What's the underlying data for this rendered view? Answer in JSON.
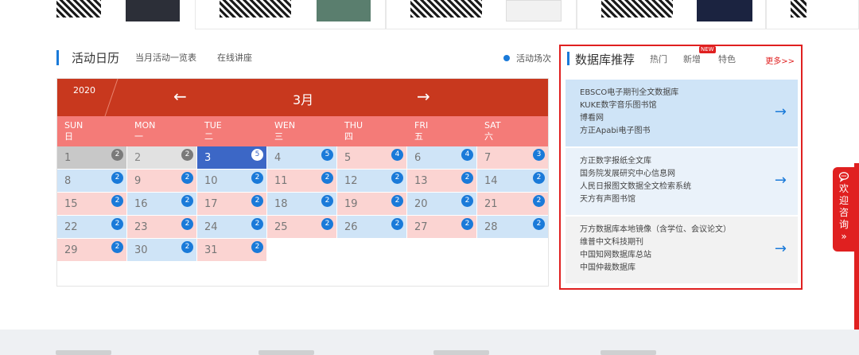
{
  "calendar": {
    "title": "活动日历",
    "tabs": [
      "当月活动一览表",
      "在线讲座"
    ],
    "legend": "活动场次",
    "year": "2020",
    "prev_arrow": "←",
    "month": "3月",
    "next_arrow": "→",
    "weekdays": [
      {
        "en": "SUN",
        "cn": "日"
      },
      {
        "en": "MON",
        "cn": "一"
      },
      {
        "en": "TUE",
        "cn": "二"
      },
      {
        "en": "WEN",
        "cn": "三"
      },
      {
        "en": "THU",
        "cn": "四"
      },
      {
        "en": "FRI",
        "cn": "五"
      },
      {
        "en": "SAT",
        "cn": "六"
      }
    ],
    "days": [
      {
        "d": "1",
        "n": "2"
      },
      {
        "d": "2",
        "n": "2"
      },
      {
        "d": "3",
        "n": "5"
      },
      {
        "d": "4",
        "n": "5"
      },
      {
        "d": "5",
        "n": "4"
      },
      {
        "d": "6",
        "n": "4"
      },
      {
        "d": "7",
        "n": "3"
      },
      {
        "d": "8",
        "n": "2"
      },
      {
        "d": "9",
        "n": "2"
      },
      {
        "d": "10",
        "n": "2"
      },
      {
        "d": "11",
        "n": "2"
      },
      {
        "d": "12",
        "n": "2"
      },
      {
        "d": "13",
        "n": "2"
      },
      {
        "d": "14",
        "n": "2"
      },
      {
        "d": "15",
        "n": "2"
      },
      {
        "d": "16",
        "n": "2"
      },
      {
        "d": "17",
        "n": "2"
      },
      {
        "d": "18",
        "n": "2"
      },
      {
        "d": "19",
        "n": "2"
      },
      {
        "d": "20",
        "n": "2"
      },
      {
        "d": "21",
        "n": "2"
      },
      {
        "d": "22",
        "n": "2"
      },
      {
        "d": "23",
        "n": "2"
      },
      {
        "d": "24",
        "n": "2"
      },
      {
        "d": "25",
        "n": "2"
      },
      {
        "d": "26",
        "n": "2"
      },
      {
        "d": "27",
        "n": "2"
      },
      {
        "d": "28",
        "n": "2"
      },
      {
        "d": "29",
        "n": "2"
      },
      {
        "d": "30",
        "n": "2"
      },
      {
        "d": "31",
        "n": "2"
      }
    ]
  },
  "database": {
    "title": "数据库推荐",
    "tabs": [
      "热门",
      "新增",
      "特色"
    ],
    "new_tag": "NEW",
    "more": "更多>>",
    "groups": [
      {
        "items": [
          "EBSCO电子期刊全文数据库",
          "KUKE数字音乐图书馆",
          "博看网",
          "方正Apabi电子图书"
        ],
        "arrow": "→"
      },
      {
        "items": [
          "方正数字报纸全文库",
          "国务院发展研究中心信息网",
          "人民日报图文数据全文检索系统",
          "天方有声图书馆"
        ],
        "arrow": "→"
      },
      {
        "items": [
          "万方数据库本地镜像（含学位、会议论文）",
          "维普中文科技期刊",
          "中国知网数据库总站",
          "中国仲裁数据库"
        ],
        "arrow": "→"
      }
    ]
  },
  "consult": {
    "icon": "chat-icon",
    "label": "欢迎咨询",
    "chevron": "»"
  },
  "colors": {
    "accent_blue": "#1a7ad9",
    "calendar_red": "#c8381e",
    "weekday_pink": "#f47b78",
    "highlight_red": "#e02020"
  }
}
